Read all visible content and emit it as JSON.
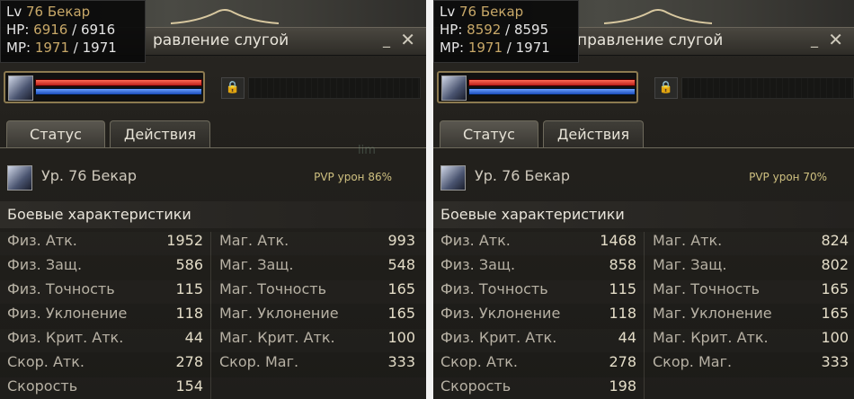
{
  "panels": [
    {
      "tooltip": {
        "lv_label": "Lv",
        "lv_value": "76 Бекар",
        "hp_label": "HP:",
        "hp_current": "6916",
        "hp_sep": " / ",
        "hp_max": "6916",
        "mp_label": "MP:",
        "mp_current": "1971",
        "mp_sep": " / ",
        "mp_max": "1971"
      },
      "window": {
        "title": "равление слугой",
        "minimize": "_",
        "close": "✕"
      },
      "tabs": {
        "status": "Статус",
        "actions": "Действия"
      },
      "info": {
        "name": "Ур. 76 Бекар",
        "pvp": "PVP урон 86%"
      },
      "section": "Боевые характеристики",
      "stats_left": [
        {
          "label": "Физ. Атк.",
          "value": "1952"
        },
        {
          "label": "Физ. Защ.",
          "value": "586"
        },
        {
          "label": "Физ. Точность",
          "value": "115"
        },
        {
          "label": "Физ. Уклонение",
          "value": "118"
        },
        {
          "label": "Физ. Крит. Атк.",
          "value": "44"
        },
        {
          "label": "Скор. Атк.",
          "value": "278"
        },
        {
          "label": "Скорость",
          "value": "154"
        }
      ],
      "stats_right": [
        {
          "label": "Маг. Атк.",
          "value": "993"
        },
        {
          "label": "Маг. Защ.",
          "value": "548"
        },
        {
          "label": "Маг. Точность",
          "value": "165"
        },
        {
          "label": "Маг. Уклонение",
          "value": "165"
        },
        {
          "label": "Маг. Крит. Атк.",
          "value": "100"
        },
        {
          "label": "Скор. Маг.",
          "value": "333"
        }
      ],
      "faint": "lim"
    },
    {
      "tooltip": {
        "lv_label": "Lv",
        "lv_value": "76 Бекар",
        "hp_label": "HP:",
        "hp_current": "8592",
        "hp_sep": " / ",
        "hp_max": "8595",
        "mp_label": "MP:",
        "mp_current": "1971",
        "mp_sep": " / ",
        "mp_max": "1971"
      },
      "window": {
        "title": "правление слугой",
        "minimize": "_",
        "close": "✕"
      },
      "tabs": {
        "status": "Статус",
        "actions": "Действия"
      },
      "info": {
        "name": "Ур. 76 Бекар",
        "pvp": "PVP урон 70%"
      },
      "section": "Боевые характеристики",
      "stats_left": [
        {
          "label": "Физ. Атк.",
          "value": "1468"
        },
        {
          "label": "Физ. Защ.",
          "value": "858"
        },
        {
          "label": "Физ. Точность",
          "value": "115"
        },
        {
          "label": "Физ. Уклонение",
          "value": "118"
        },
        {
          "label": "Физ. Крит. Атк.",
          "value": "44"
        },
        {
          "label": "Скор. Атк.",
          "value": "278"
        },
        {
          "label": "Скорость",
          "value": "198"
        }
      ],
      "stats_right": [
        {
          "label": "Маг. Атк.",
          "value": "824"
        },
        {
          "label": "Маг. Защ.",
          "value": "802"
        },
        {
          "label": "Маг. Точность",
          "value": "165"
        },
        {
          "label": "Маг. Уклонение",
          "value": "165"
        },
        {
          "label": "Маг. Крит. Атк.",
          "value": "100"
        },
        {
          "label": "Скор. Маг.",
          "value": "333"
        }
      ]
    }
  ],
  "colors": {
    "hp_bar": "#d8342a",
    "mp_bar": "#2f6ad6",
    "frame_gold": "#8c7a50"
  }
}
